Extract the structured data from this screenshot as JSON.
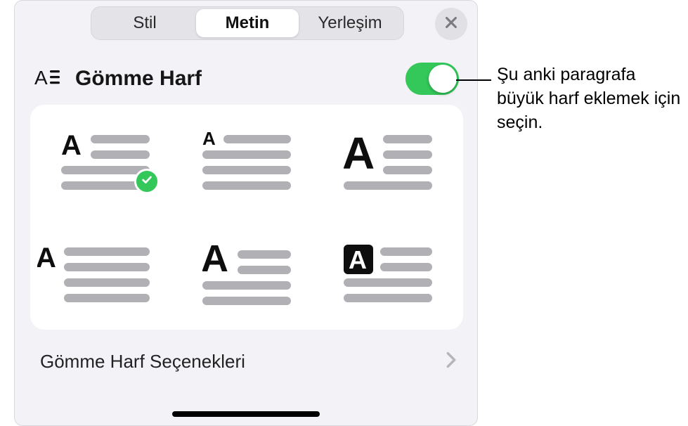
{
  "tabs": {
    "style": "Stil",
    "text": "Metin",
    "layout": "Yerleşim",
    "active": "text"
  },
  "section": {
    "title": "Gömme Harf",
    "toggle_on": true,
    "styles": [
      {
        "id": "drop-inset-small",
        "selected": true
      },
      {
        "id": "drop-inline-small",
        "selected": false
      },
      {
        "id": "drop-inset-large",
        "selected": false
      },
      {
        "id": "margin-left-small",
        "selected": false
      },
      {
        "id": "margin-left-large",
        "selected": false
      },
      {
        "id": "boxed-reverse",
        "selected": false
      }
    ],
    "options_label": "Gömme Harf Seçenekleri"
  },
  "callout": {
    "text": "Şu anki paragrafa büyük harf eklemek için seçin."
  },
  "icons": {
    "close": "close-icon",
    "dropcap": "dropcap-section-icon",
    "chevron": "chevron-right-icon",
    "check": "checkmark-icon"
  }
}
